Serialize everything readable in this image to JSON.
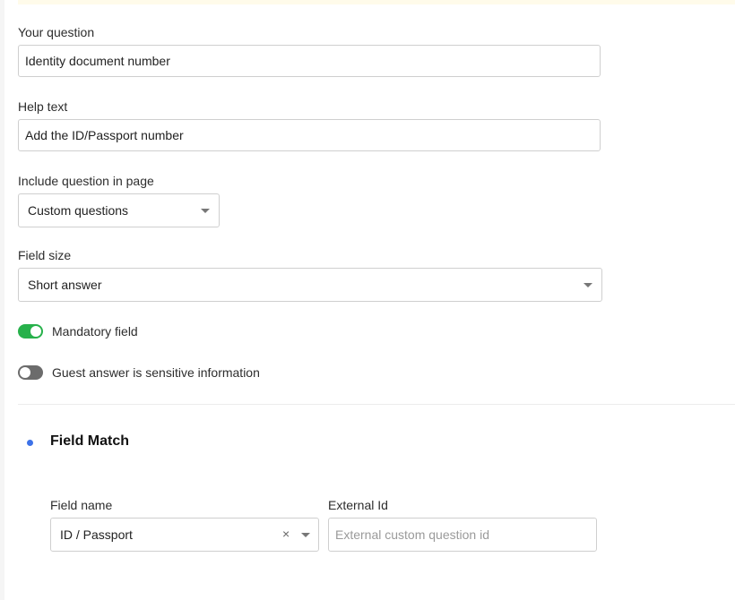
{
  "question": {
    "label": "Your question",
    "value": "Identity document number"
  },
  "help_text": {
    "label": "Help text",
    "value": "Add the ID/Passport number"
  },
  "include_in_page": {
    "label": "Include question in page",
    "selected": "Custom questions"
  },
  "field_size": {
    "label": "Field size",
    "selected": "Short answer"
  },
  "toggles": {
    "mandatory": {
      "label": "Mandatory field",
      "on": true
    },
    "sensitive": {
      "label": "Guest answer is sensitive information",
      "on": false
    }
  },
  "field_match": {
    "title": "Field Match",
    "field_name": {
      "label": "Field name",
      "selected": "ID / Passport",
      "clear_glyph": "×"
    },
    "external_id": {
      "label": "External Id",
      "value": "",
      "placeholder": "External custom question id"
    }
  },
  "colors": {
    "toggle_on": "#27b14b",
    "toggle_off": "#6c6c6c",
    "bullet": "#3d72e8",
    "banner": "#fffbea"
  },
  "icons": {
    "dropdown": "chevron-down-icon",
    "clear": "close-icon"
  }
}
